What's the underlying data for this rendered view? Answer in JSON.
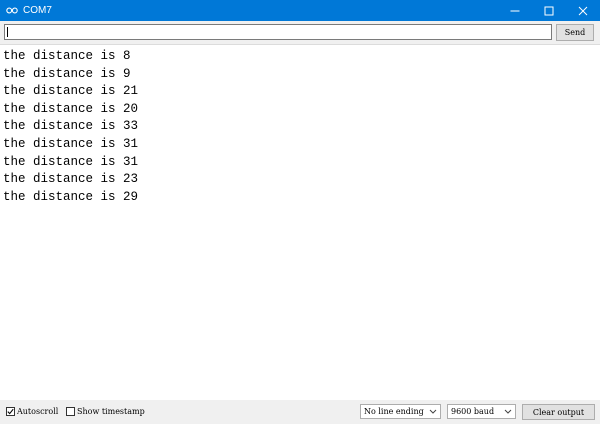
{
  "window": {
    "title": "COM7",
    "icon": "arduino-infinity-icon",
    "controls": [
      "minimize-icon",
      "maximize-icon",
      "close-icon"
    ],
    "titlebar_color": "#0078d7"
  },
  "send_bar": {
    "input_value": "",
    "send_label": "Send"
  },
  "output": {
    "lines": [
      "the distance is 8",
      "the distance is 9",
      "the distance is 21",
      "the distance is 20",
      "the distance is 33",
      "the distance is 31",
      "the distance is 31",
      "the distance is 23",
      "the distance is 29"
    ]
  },
  "bottom_bar": {
    "autoscroll": {
      "label": "Autoscroll",
      "checked": true
    },
    "show_timestamp": {
      "label": "Show timestamp",
      "checked": false
    },
    "line_ending": "No line ending",
    "baud_rate": "9600 baud",
    "clear_label": "Clear output"
  }
}
